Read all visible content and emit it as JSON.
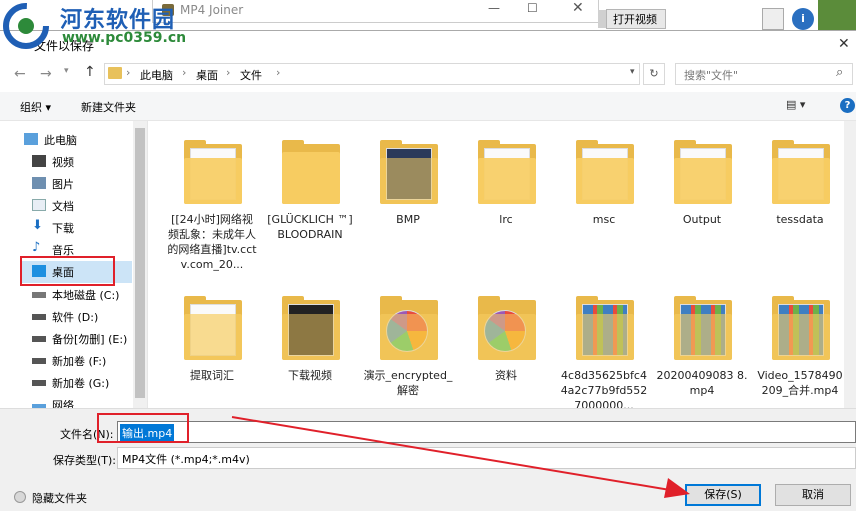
{
  "background_app": {
    "window_title": "MP4 Joiner",
    "open_video_button": "打开视频"
  },
  "watermark": {
    "site_name": "河东软件园",
    "url": "www.pc0359.cn"
  },
  "dialog": {
    "title": "文件以保存",
    "breadcrumb": [
      "此电脑",
      "桌面",
      "文件"
    ],
    "search_placeholder": "搜索\"文件\"",
    "toolbar": {
      "organize": "组织 ▾",
      "new_folder": "新建文件夹"
    },
    "nav_items": [
      {
        "label": "此电脑",
        "icon": "computer-icon"
      },
      {
        "label": "视频",
        "icon": "video-icon"
      },
      {
        "label": "图片",
        "icon": "picture-icon"
      },
      {
        "label": "文档",
        "icon": "document-icon"
      },
      {
        "label": "下载",
        "icon": "download-icon"
      },
      {
        "label": "音乐",
        "icon": "music-icon"
      },
      {
        "label": "桌面",
        "icon": "desktop-icon"
      },
      {
        "label": "本地磁盘 (C:)",
        "icon": "drive-icon"
      },
      {
        "label": "软件 (D:)",
        "icon": "drive-icon"
      },
      {
        "label": "备份[勿删] (E:)",
        "icon": "drive-icon"
      },
      {
        "label": "新加卷 (F:)",
        "icon": "drive-icon"
      },
      {
        "label": "新加卷 (G:)",
        "icon": "drive-icon"
      },
      {
        "label": "网络",
        "icon": "network-icon"
      }
    ],
    "files": [
      {
        "label": "[[24小时]网络视频乱象：未成年人的网络直播]tv.cctv.com_20...",
        "kind": "folder-docs"
      },
      {
        "label": "[GLÜCKLICH ™] BLOODRAIN",
        "kind": "folder"
      },
      {
        "label": "BMP",
        "kind": "folder-bmp"
      },
      {
        "label": "lrc",
        "kind": "folder-docs"
      },
      {
        "label": "msc",
        "kind": "folder-docs"
      },
      {
        "label": "Output",
        "kind": "folder-docs"
      },
      {
        "label": "tessdata",
        "kind": "folder-docs"
      },
      {
        "label": "提取词汇",
        "kind": "folder-doc2"
      },
      {
        "label": "下载视频",
        "kind": "folder-dark"
      },
      {
        "label": "演示_encrypted_解密",
        "kind": "folder-pie"
      },
      {
        "label": "资料",
        "kind": "folder-pie"
      },
      {
        "label": "4c8d35625bfc44a2c77b9fd5527000000...",
        "kind": "folder-photos"
      },
      {
        "label": "20200409083 8.mp4",
        "kind": "folder-photos"
      },
      {
        "label": "Video_1578490209_合并.mp4",
        "kind": "folder-photos"
      }
    ],
    "file_name_label": "文件名(N):",
    "file_name_value": "输出.mp4",
    "save_type_label": "保存类型(T):",
    "save_type_value": "MP4文件 (*.mp4;*.m4v)",
    "hide_folders": "隐藏文件夹",
    "save_button": "保存(S)",
    "cancel_button": "取消"
  }
}
